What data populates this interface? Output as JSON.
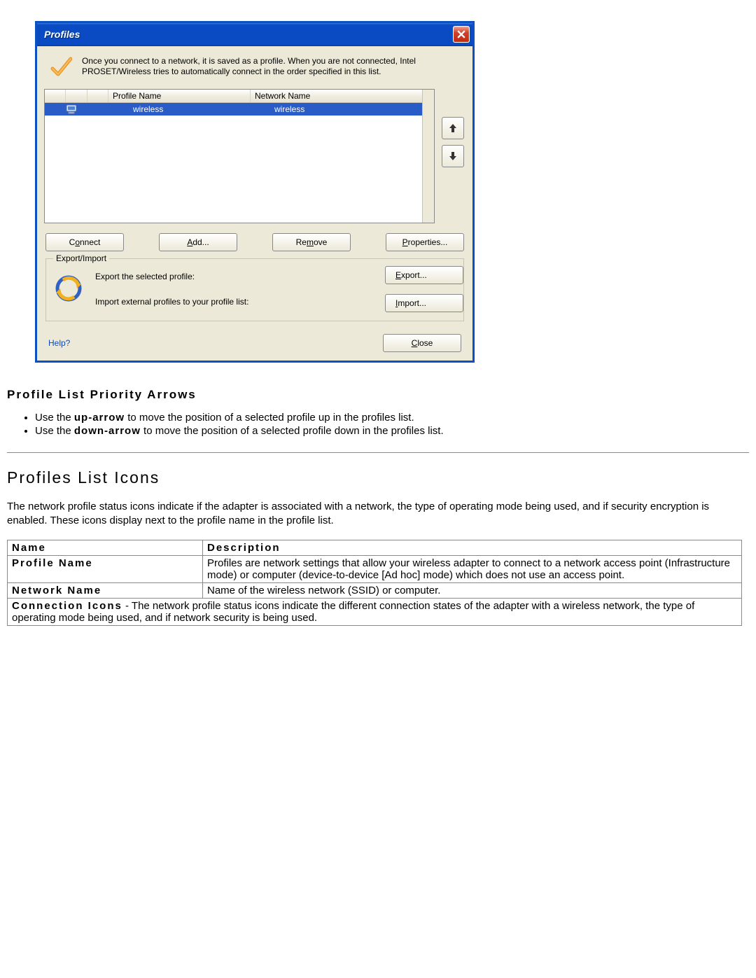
{
  "dialog": {
    "title": "Profiles",
    "intro": "Once you connect to a network, it is saved as a profile. When you are not connected, Intel PROSET/Wireless tries to automatically connect in the order specified in this list.",
    "columns": {
      "profile": "Profile Name",
      "network": "Network Name"
    },
    "row": {
      "profile": "wireless",
      "network": "wireless"
    },
    "buttons": {
      "connect": "Connect",
      "add": "Add...",
      "remove": "Remove",
      "properties": "Properties..."
    },
    "export_import": {
      "legend": "Export/Import",
      "export_label": "Export the selected profile:",
      "import_label": "Import external profiles to your profile list:",
      "export_btn": "Export...",
      "import_btn": "Import..."
    },
    "help": "Help?",
    "close": "Close"
  },
  "doc": {
    "h3": "Profile List Priority Arrows",
    "li1a": "Use the ",
    "li1b": "up-arrow",
    "li1c": " to move the position of a selected profile up in the profiles list.",
    "li2a": "Use the ",
    "li2b": "down-arrow",
    "li2c": " to move the position of a selected profile down in the profiles list.",
    "h2": "Profiles List Icons",
    "p1": "The network profile status icons indicate if the adapter is associated with a network, the type of operating mode being used, and if security encryption is enabled. These icons display next to the profile name in the profile list.",
    "table": {
      "name_h": "Name",
      "desc_h": "Description",
      "r1_name": "Profile Name",
      "r1_desc": "Profiles are network settings that allow your wireless adapter to connect to a network access point (Infrastructure mode) or computer (device-to-device [Ad hoc] mode) which does not use an access point.",
      "r2_name": "Network Name",
      "r2_desc": "Name of the wireless network (SSID) or computer.",
      "r3a": "Connection Icons",
      "r3b": " - The network profile status icons indicate the different connection states of the adapter with a wireless network, the type of operating mode being used, and if network security is being used."
    }
  }
}
